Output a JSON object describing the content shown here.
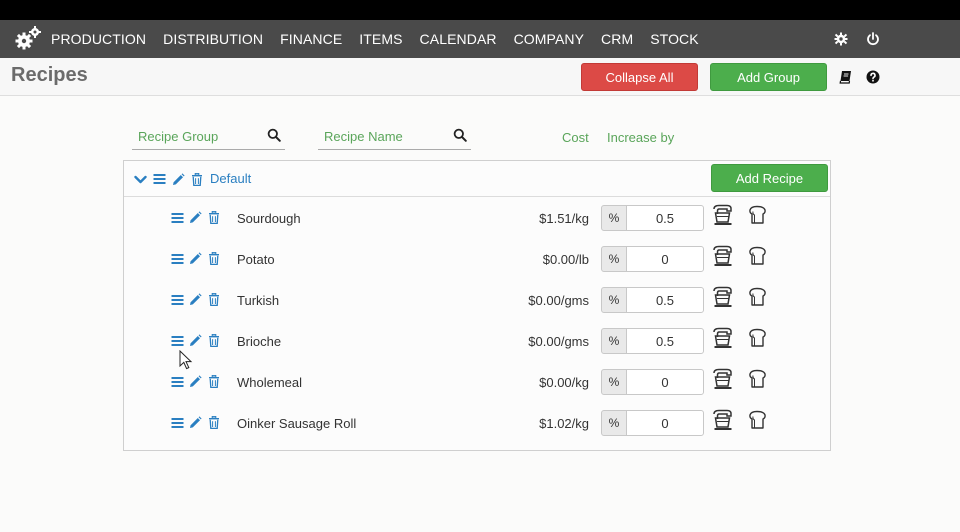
{
  "nav": {
    "items": [
      "PRODUCTION",
      "DISTRIBUTION",
      "FINANCE",
      "ITEMS",
      "CALENDAR",
      "COMPANY",
      "CRM",
      "STOCK"
    ],
    "icons": [
      "gears-icon",
      "gear-icon",
      "power-icon"
    ]
  },
  "header": {
    "title": "Recipes",
    "collapse_all": "Collapse All",
    "add_group": "Add Group",
    "icons": [
      "book-icon",
      "help-icon"
    ]
  },
  "filters": {
    "recipe_group_placeholder": "Recipe Group",
    "recipe_name_placeholder": "Recipe Name",
    "cost_label": "Cost",
    "increase_label": "Increase by"
  },
  "group": {
    "name": "Default",
    "add_recipe": "Add Recipe"
  },
  "recipes": [
    {
      "name": "Sourdough",
      "cost": "$1.51/kg",
      "unit": "%",
      "increase": "0.5"
    },
    {
      "name": "Potato",
      "cost": "$0.00/lb",
      "unit": "%",
      "increase": "0"
    },
    {
      "name": "Turkish",
      "cost": "$0.00/gms",
      "unit": "%",
      "increase": "0.5"
    },
    {
      "name": "Brioche",
      "cost": "$0.00/gms",
      "unit": "%",
      "increase": "0.5"
    },
    {
      "name": "Wholemeal",
      "cost": "$0.00/kg",
      "unit": "%",
      "increase": "0"
    },
    {
      "name": "Oinker Sausage Roll",
      "cost": "$1.02/kg",
      "unit": "%",
      "increase": "0"
    }
  ],
  "colors": {
    "accent_blue": "#2a7fc1",
    "green": "#4cae4c",
    "red": "#dc4a46",
    "navbar": "#4a4a4a"
  }
}
